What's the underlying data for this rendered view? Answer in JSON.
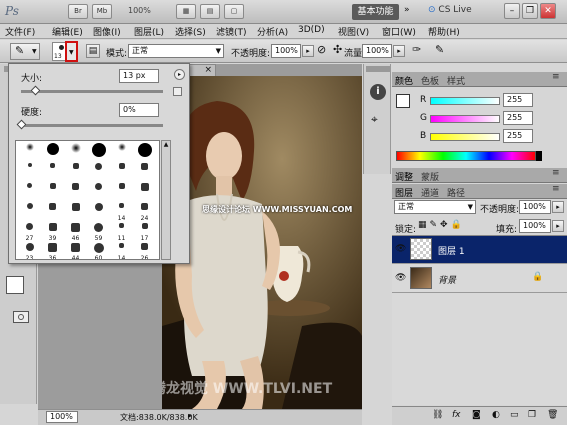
{
  "titlebar": {
    "app_logo": "Ps",
    "mode_btn1": "Br",
    "mode_btn2": "Mb",
    "zoom": "100%",
    "workspace": "基本功能",
    "cs_live": "CS Live"
  },
  "menu": [
    "文件(F)",
    "编辑(E)",
    "图像(I)",
    "图层(L)",
    "选择(S)",
    "滤镜(T)",
    "分析(A)",
    "3D(D)",
    "视图(V)",
    "窗口(W)",
    "帮助(H)"
  ],
  "options": {
    "brush_size": "13",
    "mode_label": "模式:",
    "mode_value": "正常",
    "opacity_label": "不透明度:",
    "opacity_value": "100%",
    "flow_label": "流量:",
    "flow_value": "100%"
  },
  "brush_picker": {
    "size_label": "大小:",
    "size_value": "13 px",
    "size_level": 0.1,
    "hardness_label": "硬度:",
    "hardness_value": "0%",
    "hardness_level": 0.0,
    "row_numbers": [
      [
        "",
        "",
        "",
        "",
        "",
        ""
      ],
      [
        "",
        "",
        "",
        "",
        "",
        ""
      ],
      [
        "",
        "",
        "",
        "",
        "",
        ""
      ],
      [
        "",
        "",
        "",
        "",
        "14",
        "24"
      ],
      [
        "27",
        "39",
        "46",
        "59",
        "11",
        "17"
      ],
      [
        "23",
        "36",
        "44",
        "60",
        "14",
        "26"
      ]
    ]
  },
  "document": {
    "zoom": "100%",
    "doc_info": "文档:838.0K/838.0K"
  },
  "watermarks": {
    "top": "思缘设计论坛 WWW.MISSYUAN.COM",
    "bottom": "腾龙视觉 WWW.TLVI.NET"
  },
  "color_panel": {
    "tabs": [
      "颜色",
      "色板",
      "样式"
    ],
    "r_label": "R",
    "g_label": "G",
    "b_label": "B",
    "r_value": "255",
    "g_value": "255",
    "b_value": "255",
    "slider_level": 1.0
  },
  "adjust_panel": {
    "tabs": [
      "调整",
      "蒙版"
    ]
  },
  "layers_panel": {
    "tabs": [
      "图层",
      "通道",
      "路径"
    ],
    "blend_mode": "正常",
    "opacity_label": "不透明度:",
    "opacity_value": "100%",
    "lock_label": "锁定:",
    "fill_label": "填充:",
    "fill_value": "100%",
    "layers": [
      {
        "name": "图层 1",
        "selected": true
      },
      {
        "name": "背景",
        "selected": false
      }
    ]
  },
  "colors": {
    "selection_blue": "#0a246a",
    "accent_red": "#d01010"
  }
}
